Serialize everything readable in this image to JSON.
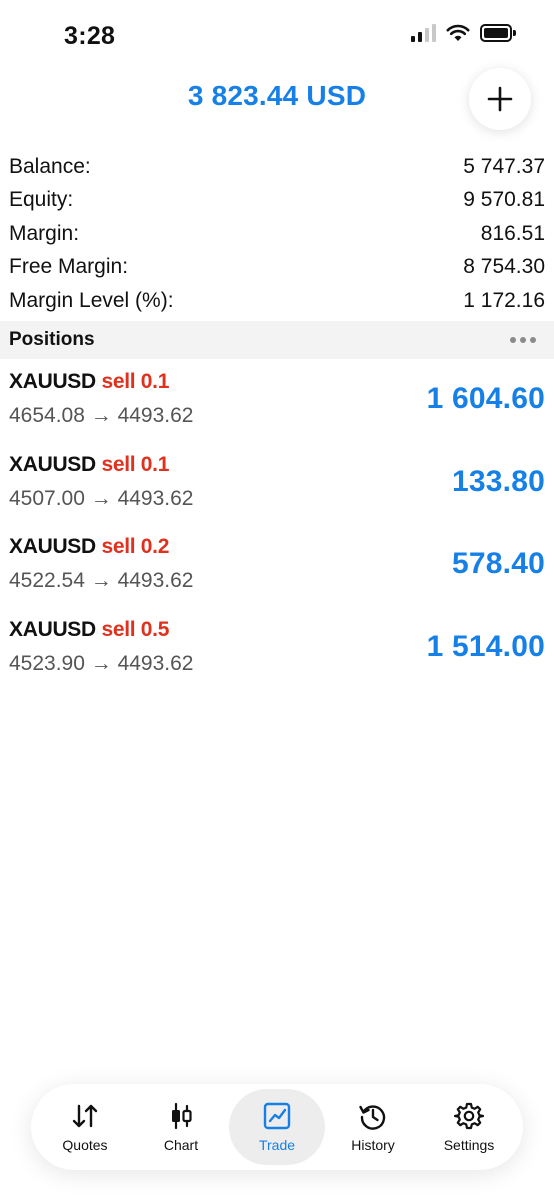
{
  "status_bar": {
    "time": "3:28"
  },
  "header": {
    "title": "3 823.44 USD"
  },
  "summary": [
    {
      "label": "Balance:",
      "value": "5 747.37"
    },
    {
      "label": "Equity:",
      "value": "9 570.81"
    },
    {
      "label": "Margin:",
      "value": "816.51"
    },
    {
      "label": "Free Margin:",
      "value": "8 754.30"
    },
    {
      "label": "Margin Level (%):",
      "value": "1 172.16"
    }
  ],
  "positions_section": {
    "title": "Positions"
  },
  "positions": [
    {
      "symbol": "XAUUSD",
      "direction": "sell 0.1",
      "prices": "4654.08 → 4493.62",
      "profit": "1 604.60"
    },
    {
      "symbol": "XAUUSD",
      "direction": "sell 0.1",
      "prices": "4507.00 → 4493.62",
      "profit": "133.80"
    },
    {
      "symbol": "XAUUSD",
      "direction": "sell 0.2",
      "prices": "4522.54 → 4493.62",
      "profit": "578.40"
    },
    {
      "symbol": "XAUUSD",
      "direction": "sell 0.5",
      "prices": "4523.90 → 4493.62",
      "profit": "1 514.00"
    }
  ],
  "tabs": [
    {
      "label": "Quotes",
      "icon": "quotes-arrows-icon"
    },
    {
      "label": "Chart",
      "icon": "candlestick-icon"
    },
    {
      "label": "Trade",
      "icon": "trade-chart-icon"
    },
    {
      "label": "History",
      "icon": "history-clock-icon"
    },
    {
      "label": "Settings",
      "icon": "gear-icon"
    }
  ],
  "colors": {
    "accent": "#1680e6",
    "sell": "#e0301e"
  }
}
